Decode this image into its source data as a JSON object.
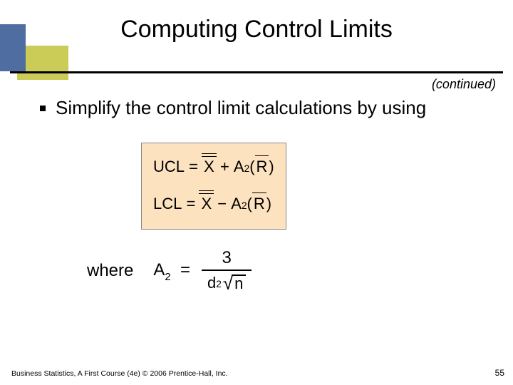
{
  "title": "Computing Control Limits",
  "continued": "(continued)",
  "bullet": "Simplify the control limit calculations by using",
  "formula": {
    "ucl": {
      "lhs": "UCL",
      "eq": "=",
      "op": "+",
      "A": "A",
      "sub": "2",
      "lparen": "(",
      "rparen": ")",
      "X": "X",
      "R": "R"
    },
    "lcl": {
      "lhs": "LCL",
      "eq": "=",
      "op": "−",
      "A": "A",
      "sub": "2",
      "lparen": "(",
      "rparen": ")",
      "X": "X",
      "R": "R"
    }
  },
  "where": {
    "label": "where",
    "A": "A",
    "sub": "2",
    "eq": "=",
    "numerator": "3",
    "d": "d",
    "dsub": "2",
    "n": "n"
  },
  "footer": "Business Statistics, A First Course (4e) © 2006 Prentice-Hall, Inc.",
  "page": "55"
}
